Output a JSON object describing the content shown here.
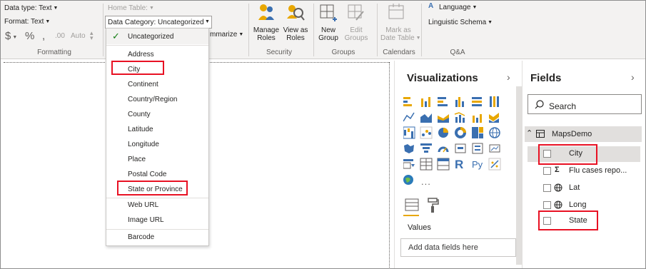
{
  "ribbon": {
    "data_type": "Data type: Text",
    "format": "Format: Text",
    "currency_symbol": "$",
    "percent_symbol": "%",
    "comma_symbol": ",",
    "decimal_auto": "Auto",
    "formatting_label": "Formatting",
    "home_table": "Home Table:",
    "data_category": "Data Category: Uncategorized",
    "summarize": "mmarize",
    "manage_roles": [
      "Manage",
      "Roles"
    ],
    "view_as_roles": [
      "View as",
      "Roles"
    ],
    "security_label": "Security",
    "new_group": [
      "New",
      "Group"
    ],
    "edit_groups": [
      "Edit",
      "Groups"
    ],
    "groups_label": "Groups",
    "mark_as_date_table": [
      "Mark as",
      "Date Table"
    ],
    "calendars_label": "Calendars",
    "language": "Language",
    "linguistic_schema": "Linguistic Schema",
    "qa_label": "Q&A"
  },
  "dropdown": {
    "selected": "Uncategorized",
    "items": [
      "Uncategorized",
      "Address",
      "City",
      "Continent",
      "Country/Region",
      "County",
      "Latitude",
      "Longitude",
      "Place",
      "Postal Code",
      "State or Province",
      "Web URL",
      "Image URL",
      "Barcode"
    ]
  },
  "visualizations": {
    "title": "Visualizations",
    "more_label": "...",
    "values_label": "Values",
    "add_fields_placeholder": "Add data fields here"
  },
  "fields": {
    "title": "Fields",
    "search_placeholder": "Search",
    "table_name": "MapsDemo",
    "items": [
      {
        "label": "City",
        "icon": "none"
      },
      {
        "label": "Flu cases repo...",
        "icon": "sigma"
      },
      {
        "label": "Lat",
        "icon": "globe"
      },
      {
        "label": "Long",
        "icon": "globe"
      },
      {
        "label": "State",
        "icon": "none"
      }
    ]
  },
  "colors": {
    "accent_yellow": "#e8a700",
    "highlight_red": "#e81123",
    "check_green": "#107c10"
  }
}
